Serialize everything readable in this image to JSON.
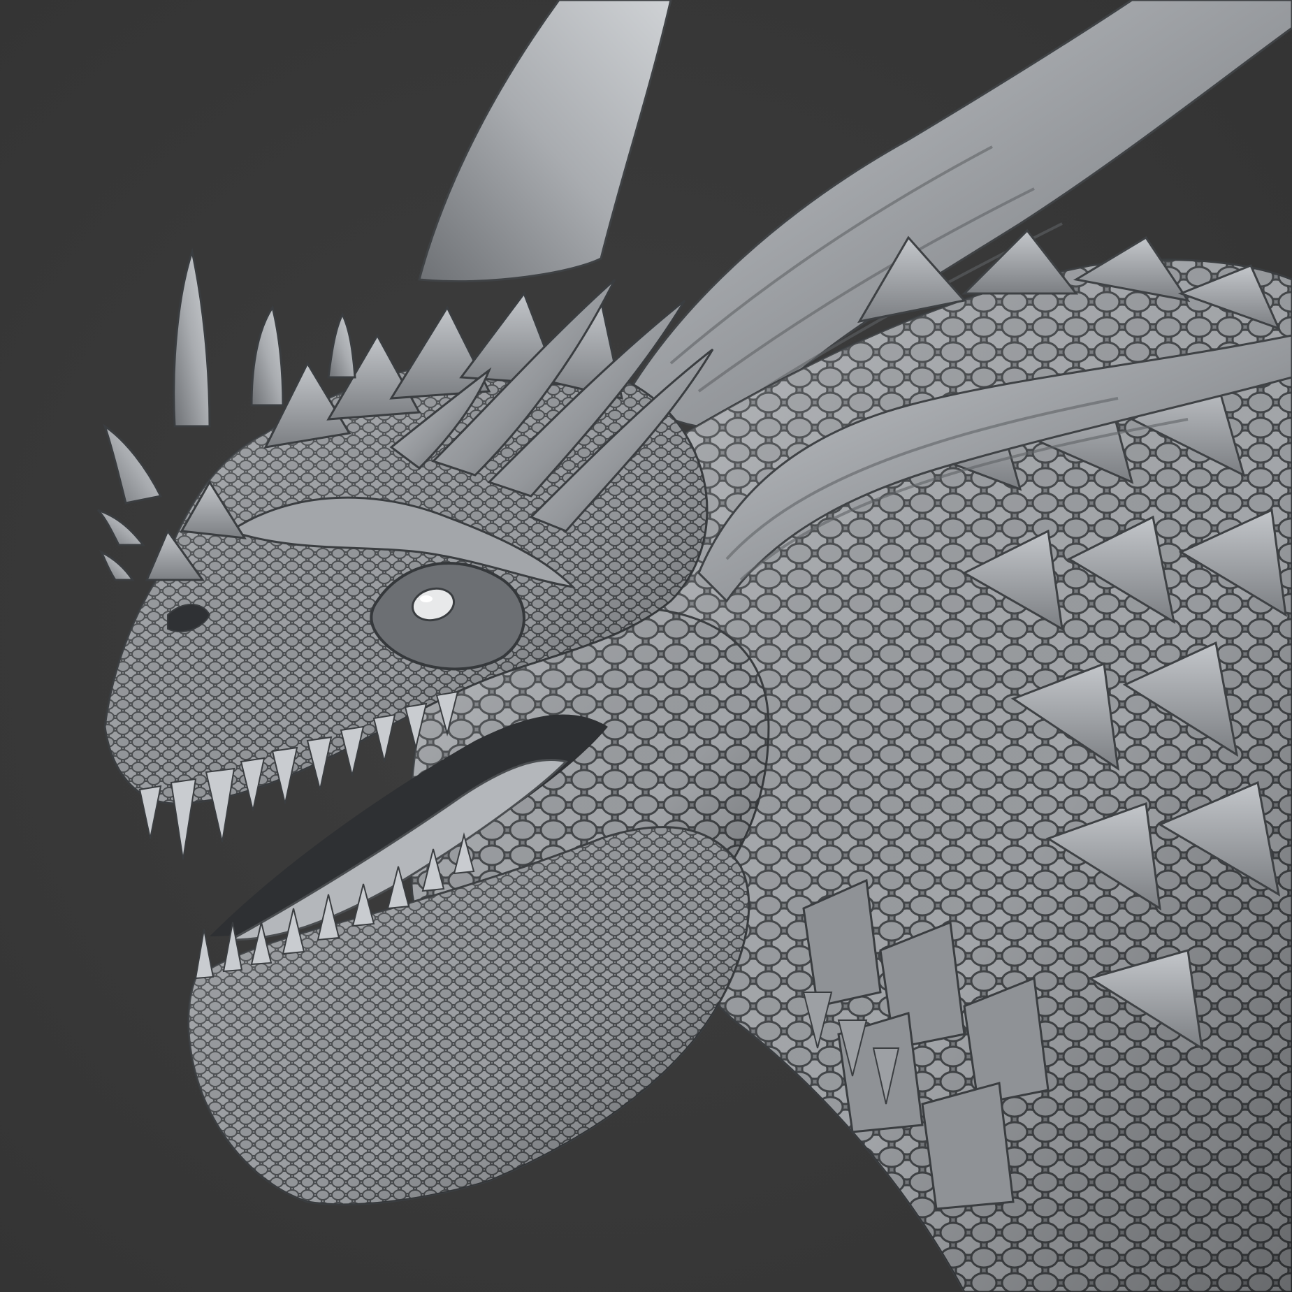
{
  "scene": {
    "subject": "dragon-head-sculpt",
    "colors": {
      "background": "#3a3a3a",
      "clay_light": "#b9bcc0",
      "clay_mid": "#8a8d91",
      "clay_dark": "#4a4c4f",
      "eye": "#e8e9ea"
    }
  }
}
